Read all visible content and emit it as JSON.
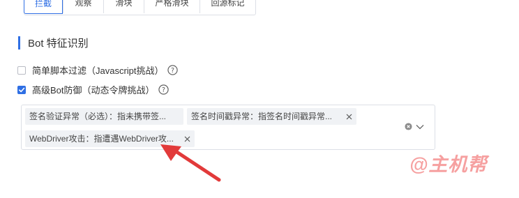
{
  "action_tabs": [
    {
      "label": "拦截",
      "active": true
    },
    {
      "label": "观察",
      "active": false
    },
    {
      "label": "滑块",
      "active": false
    },
    {
      "label": "严格滑块",
      "active": false
    },
    {
      "label": "回源标记",
      "active": false
    }
  ],
  "section": {
    "title": "Bot 特征识别"
  },
  "options": {
    "js_filter": {
      "label": "简单脚本过滤（Javascript挑战）",
      "checked": false,
      "help_icon": "question-circle-icon"
    },
    "advanced_bot": {
      "label": "高级Bot防御（动态令牌挑战）",
      "checked": true,
      "help_icon": "question-circle-icon"
    }
  },
  "selected_tags": [
    {
      "label": "签名验证异常（必选）：指未携带签...",
      "removable": false
    },
    {
      "label": "签名时间戳异常：指签名时间戳异常...",
      "removable": true
    },
    {
      "label": "WebDriver攻击：指遭遇WebDriver攻...",
      "removable": true
    }
  ],
  "multiselect_icons": [
    "clear-circle-icon",
    "chevron-down-icon"
  ],
  "watermark": "@主机帮",
  "colors": {
    "accent": "#2f6fe4",
    "annotation": "#e23a3a",
    "watermark": "#f6a0a0",
    "tag_bg": "#f0f2f5"
  }
}
